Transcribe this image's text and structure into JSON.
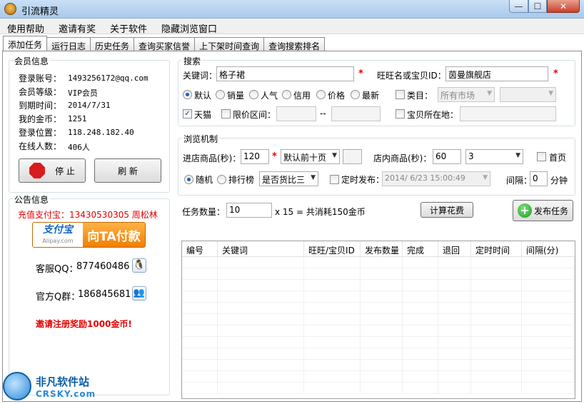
{
  "window": {
    "title": "引流精灵",
    "min": "—",
    "max": "☐",
    "close": "✕"
  },
  "menu": [
    "使用帮助",
    "邀请有奖",
    "关于软件",
    "隐藏浏览窗口"
  ],
  "tabs": [
    "添加任务",
    "运行日志",
    "历史任务",
    "查询买家信誉",
    "上下架时间查询",
    "查询搜索排名"
  ],
  "member": {
    "title": "会员信息",
    "rows": [
      {
        "label": "登录账号：",
        "value": "1493256172@qq.com"
      },
      {
        "label": "会员等级：",
        "value": "VIP会员"
      },
      {
        "label": "到期时间：",
        "value": "2014/7/31"
      },
      {
        "label": "我的金币：",
        "value": "1251"
      },
      {
        "label": "登录位置：",
        "value": "118.248.182.40"
      },
      {
        "label": "在线人数：",
        "value": "406人"
      }
    ],
    "stop_label": "停 止",
    "refresh_label": "刷 新"
  },
  "notice": {
    "title": "公告信息",
    "recharge": "充值支付宝：13430530305 周松林",
    "alipay_logo": "支付宝",
    "alipay_domain": "Alipay.com",
    "alipay_pay": "向TA付款",
    "qq_label": "客服QQ：",
    "qq_value": "877460486",
    "group_label": "官方Q群：",
    "group_value": "186845681",
    "invite": "邀请注册奖励1000金币!"
  },
  "search": {
    "title": "搜索",
    "keyword_label": "关键词：",
    "keyword_value": "格子裙",
    "wangwang_label": "旺旺名或宝贝ID：",
    "wangwang_value": "茵曼旗舰店",
    "sort_options": [
      "默认",
      "销量",
      "人气",
      "信用",
      "价格",
      "最新"
    ],
    "category_label": "类目：",
    "category_value": "所有市场",
    "tmall_label": "天猫",
    "price_label": "限价区间：",
    "price_sep": "--",
    "location_label": "宝贝所在地："
  },
  "browse": {
    "title": "浏览机制",
    "enter_label": "进店商品(秒)：",
    "enter_value": "120",
    "enter_select": "默认前十页",
    "inshop_label": "店内商品(秒)：",
    "inshop_value": "60",
    "inshop_select": "3",
    "home_label": "首页",
    "random_label": "随机",
    "rank_label": "排行榜",
    "compare_select": "是否货比三",
    "schedule_label": "定时发布：",
    "schedule_value": "2014/ 6/23 15:00:49",
    "interval_label": "间隔：",
    "interval_value": "0",
    "interval_unit": "分钟"
  },
  "task": {
    "count_label": "任务数量：",
    "count_value": "10",
    "summary": "x 15 = 共消耗150金币",
    "calc_label": "计算花费",
    "publish_label": "发布任务"
  },
  "table": {
    "headers": [
      "编号",
      "关键词",
      "旺旺/宝贝ID",
      "发布数量",
      "完成",
      "退回",
      "定时时间",
      "间隔(分)"
    ]
  },
  "watermark": {
    "cn": "非凡软件站",
    "en": "CRSKY.com"
  }
}
